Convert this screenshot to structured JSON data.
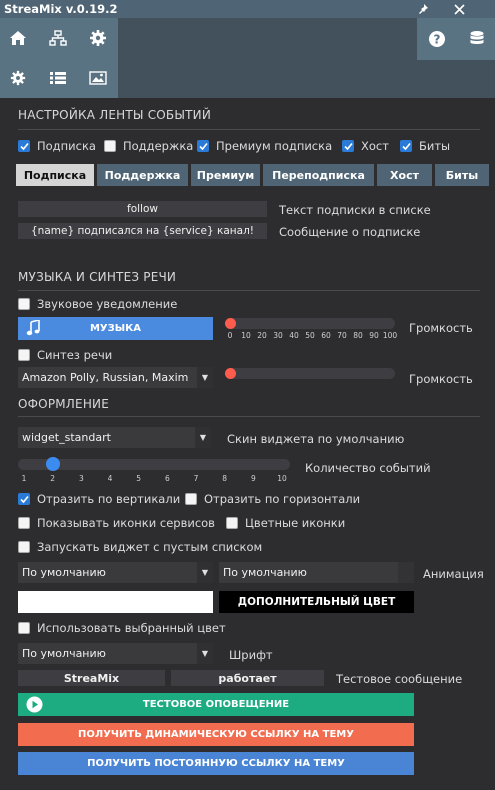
{
  "window": {
    "title": "StreaMix v.0.19.2"
  },
  "titlebar": {
    "pin_icon": "pin-icon",
    "close_icon": "close-icon"
  },
  "header": {
    "left_icons": [
      "home-icon",
      "network-icon",
      "gear-icon",
      "gear-small-icon",
      "list-icon",
      "image-icon"
    ],
    "right_icons": [
      "help-icon",
      "database-icon"
    ]
  },
  "events": {
    "section_title": "НАСТРОЙКА ЛЕНТЫ СОБЫТИЙ",
    "filters": [
      {
        "label": "Подписка",
        "checked": true
      },
      {
        "label": "Поддержка",
        "checked": false
      },
      {
        "label": "Премиум подписка",
        "checked": true
      },
      {
        "label": "Хост",
        "checked": true
      },
      {
        "label": "Биты",
        "checked": true
      }
    ],
    "tabs": [
      {
        "label": "Подписка",
        "active": true
      },
      {
        "label": "Поддержка",
        "active": false
      },
      {
        "label": "Премиум",
        "active": false
      },
      {
        "label": "Переподписка",
        "active": false
      },
      {
        "label": "Хост",
        "active": false
      },
      {
        "label": "Биты",
        "active": false
      }
    ],
    "list_text_value": "follow",
    "list_text_label": "Текст подписки в списке",
    "message_value": "{name} подписался на {service} канал!",
    "message_label": "Сообщение о подписке"
  },
  "music": {
    "section_title": "МУЗЫКА И СИНТЕЗ РЕЧИ",
    "sound_alert": {
      "label": "Звуковое уведомление",
      "checked": false
    },
    "music_button": "МУЗЫКА",
    "volume_label": "Громкость",
    "volume_ticks": [
      "0",
      "10",
      "20",
      "30",
      "40",
      "50",
      "60",
      "70",
      "80",
      "90",
      "100"
    ],
    "volume_value": 0,
    "tts": {
      "label": "Синтез речи",
      "checked": false
    },
    "voice_value": "Amazon Polly, Russian, Maxim",
    "tts_volume_label": "Громкость",
    "tts_volume_value": 0
  },
  "design": {
    "section_title": "ОФОРМЛЕНИЕ",
    "skin_value": "widget_standart",
    "skin_label": "Скин виджета по умолчанию",
    "events_count_label": "Количество событий",
    "events_count_ticks": [
      "1",
      "2",
      "3",
      "4",
      "5",
      "6",
      "7",
      "8",
      "9",
      "10"
    ],
    "events_count_value": 2,
    "mirror_vertical": {
      "label": "Отразить по вертикали",
      "checked": true
    },
    "mirror_horizontal": {
      "label": "Отразить по горизонтали",
      "checked": false
    },
    "show_service_icons": {
      "label": "Показывать иконки сервисов",
      "checked": false
    },
    "color_icons": {
      "label": "Цветные иконки",
      "checked": false
    },
    "empty_list": {
      "label": "Запускать виджет с пустым списком",
      "checked": false
    },
    "animation_in": "По умолчанию",
    "animation_out": "По умолчанию",
    "animation_label": "Анимация",
    "primary_color": "#ffffff",
    "secondary_color_button": "ДОПОЛНИТЕЛЬНЫЙ ЦВЕТ",
    "secondary_color": "#000000",
    "use_selected_color": {
      "label": "Использовать выбранный цвет",
      "checked": false
    },
    "font_value": "По умолчанию",
    "font_label": "Шрифт",
    "test_word1": "StreaMix",
    "test_word2": "работает",
    "test_message_label": "Тестовое сообщение"
  },
  "actions": {
    "test_alert": "ТЕСТОВОЕ ОПОВЕЩЕНИЕ",
    "dynamic_link": "ПОЛУЧИТЬ ДИНАМИЧЕСКУЮ ССЫЛКУ НА ТЕМУ",
    "permanent_link": "ПОЛУЧИТЬ ПОСТОЯННУЮ ССЫЛКУ НА ТЕМУ"
  },
  "colors": {
    "accent_blue": "#4a8be0",
    "test_alert_green": "#1dab82",
    "dynamic_link_orange": "#f26d4f",
    "permanent_link_blue": "#4a84d4",
    "slider_red": "#ff5c4d",
    "slider_blue": "#3c8cf0"
  }
}
